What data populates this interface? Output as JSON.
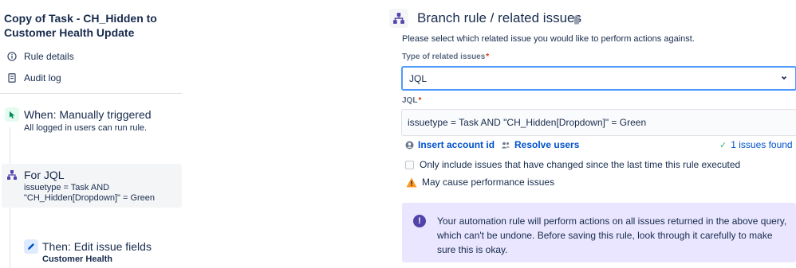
{
  "sidebar": {
    "rule_title": "Copy of Task - CH_Hidden to Customer Health Update",
    "nav": {
      "rule_details": "Rule details",
      "audit_log": "Audit log"
    }
  },
  "steps": {
    "trigger": {
      "title": "When: Manually triggered",
      "description": "All logged in users can run rule.",
      "icon": "cursor-click-icon"
    },
    "branch": {
      "title": "For JQL",
      "description": "issuetype = Task AND \"CH_Hidden[Dropdown]\" = Green",
      "icon": "branch-icon"
    },
    "action": {
      "title": "Then: Edit issue fields",
      "description": "Customer Health",
      "icon": "pencil-icon"
    }
  },
  "editor": {
    "title": "Branch rule / related issues",
    "help_text": "Please select which related issue you would like to perform actions against.",
    "type_label": "Type of related issues",
    "type_value": "JQL",
    "jql_label": "JQL",
    "required_marker": "*",
    "jql_value": "issuetype = Task AND \"CH_Hidden[Dropdown]\" = Green",
    "insert_account_id": "Insert account id",
    "resolve_users": "Resolve users",
    "issues_found": "1 issues found",
    "check_changed_label": "Only include issues that have changed since the last time this rule executed",
    "check_changed_value": false,
    "warning": "May cause performance issues",
    "info": "Your automation rule will perform actions on all issues returned in the above query, which can't be undone. Before saving this rule, look through it carefully to make sure this is okay."
  },
  "colors": {
    "link": "#0052cc",
    "focus_border": "#4c9aff",
    "info_bg": "#eae6ff",
    "info_icon": "#5243aa",
    "success": "#36b37e",
    "warning": "#ff991f",
    "required": "#de350b"
  }
}
